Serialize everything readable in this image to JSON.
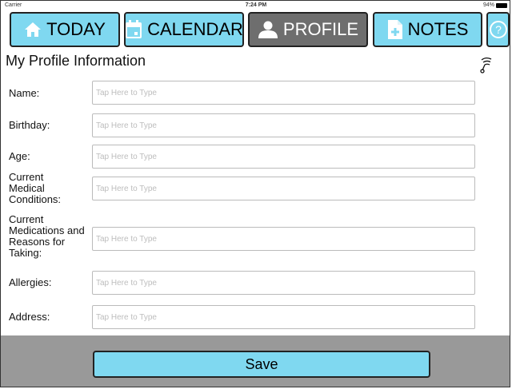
{
  "status_bar": {
    "carrier": "Carrier",
    "time": "7:24 PM",
    "battery": "94%"
  },
  "tabs": [
    {
      "label": "TODAY",
      "icon": "home-icon"
    },
    {
      "label": "CALENDAR",
      "icon": "calendar-icon"
    },
    {
      "label": "PROFILE",
      "icon": "person-icon",
      "active": true
    },
    {
      "label": "NOTES",
      "icon": "note-add-icon"
    }
  ],
  "help": {
    "icon": "help-icon",
    "glyph": "?"
  },
  "page": {
    "title": "My Profile Information",
    "signal_icon": "signal-icon"
  },
  "form": {
    "fields": [
      {
        "label": "Name:",
        "placeholder": "Tap Here to Type",
        "value": ""
      },
      {
        "label": "Birthday:",
        "placeholder": "Tap Here to Type",
        "value": ""
      },
      {
        "label": "Age:",
        "placeholder": "Tap Here to Type",
        "value": ""
      },
      {
        "label": "Current Medical Conditions:",
        "placeholder": "Tap Here to Type",
        "value": ""
      },
      {
        "label": "Current Medications and Reasons for Taking:",
        "placeholder": "Tap Here to Type",
        "value": ""
      },
      {
        "label": "Allergies:",
        "placeholder": "Tap Here to Type",
        "value": ""
      },
      {
        "label": "Address:",
        "placeholder": "Tap Here to Type",
        "value": ""
      }
    ]
  },
  "footer": {
    "save_label": "Save"
  },
  "colors": {
    "accent": "#7fd8f0",
    "active_tab": "#6e6e6e",
    "footer": "#999999",
    "border": "#222222"
  }
}
